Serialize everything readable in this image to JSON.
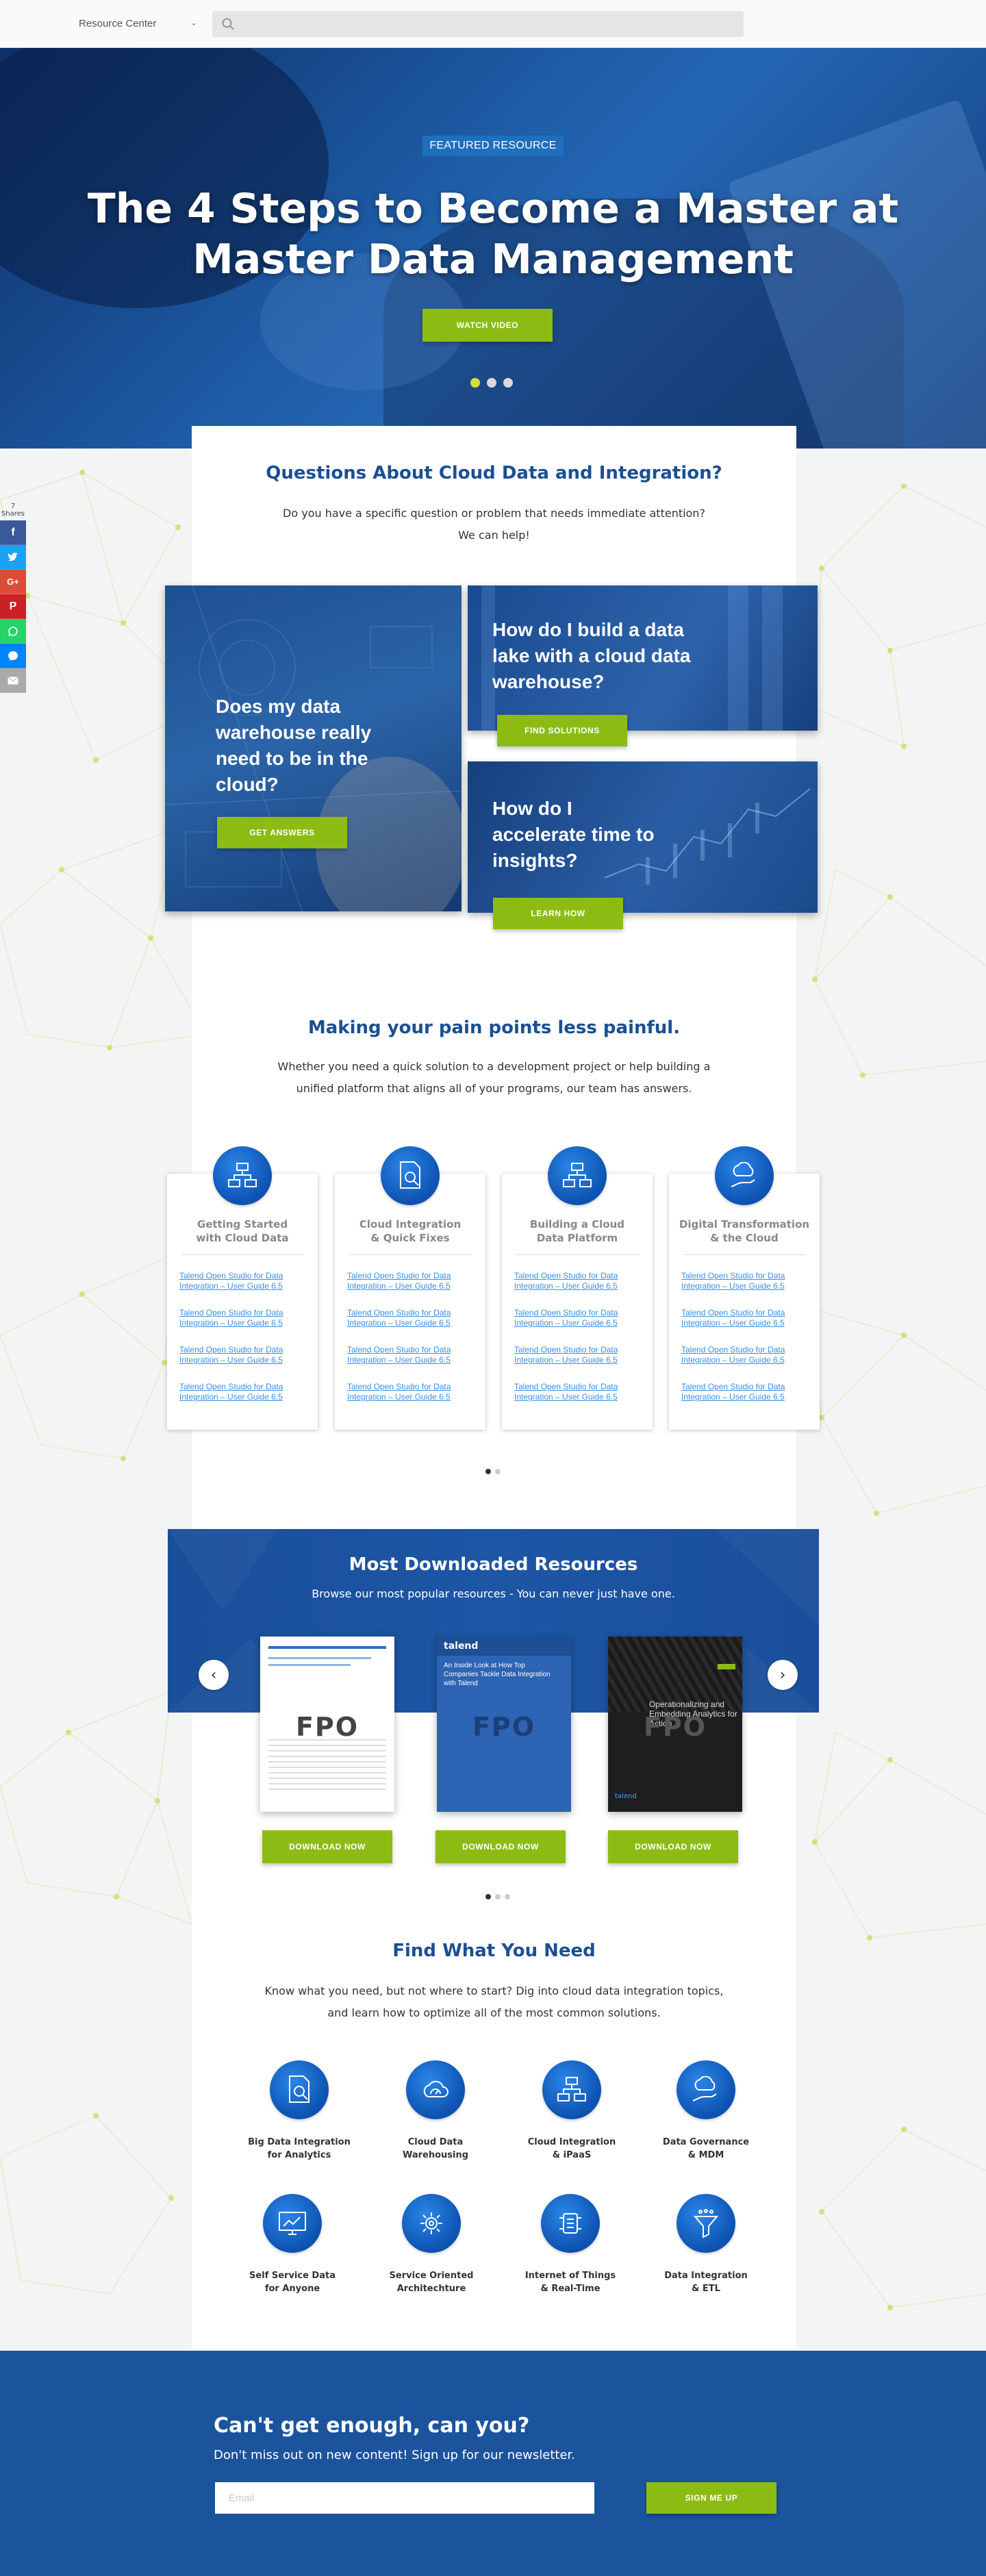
{
  "nav": {
    "brand": "Resource Center",
    "search_placeholder": ""
  },
  "hero": {
    "tag": "FEATURED RESOURCE",
    "title": "The 4 Steps to Become a Master at Master Data Management",
    "button": "WATCH VIDEO",
    "slides": 3,
    "active_slide": 1
  },
  "share": {
    "count": "7",
    "count_label": "Shares",
    "buttons": [
      "facebook",
      "twitter",
      "google-plus",
      "pinterest",
      "whatsapp",
      "messenger",
      "email"
    ]
  },
  "questions": {
    "title": "Questions About Cloud Data and Integration?",
    "subtitle_line1": "Do you have a specific question or problem that needs immediate attention?",
    "subtitle_line2": "We can help!",
    "cards": [
      {
        "text": "Does my data warehouse really need to be in the cloud?",
        "button": "GET ANSWERS"
      },
      {
        "text": "How do I build a data lake with a cloud data warehouse?",
        "button": "FIND SOLUTIONS"
      },
      {
        "text": "How do I accelerate time to insights?",
        "button": "LEARN HOW"
      }
    ]
  },
  "pain": {
    "title": "Making your pain points less painful.",
    "subtitle_line1": "Whether you need a quick solution to a development project or help building a",
    "subtitle_line2": "unified platform that aligns all of your programs, our team has answers.",
    "cards": [
      {
        "title_line1": "Getting Started",
        "title_line2": "with Cloud Data",
        "icon": "database-network-icon",
        "links": [
          "Talend Open Studio for Data Integration – User Guide 6.5",
          "Talend Open Studio for Data Integration – User Guide 6.5",
          "Talend Open Studio for Data Integration – User Guide 6.5",
          "Talend Open Studio for Data Integration – User Guide 6.5"
        ]
      },
      {
        "title_line1": "Cloud Integration",
        "title_line2": "& Quick Fixes",
        "icon": "document-search-icon",
        "links": [
          "Talend Open Studio for Data Integration – User Guide 6.5",
          "Talend Open Studio for Data Integration – User Guide 6.5",
          "Talend Open Studio for Data Integration – User Guide 6.5",
          "Talend Open Studio for Data Integration – User Guide 6.5"
        ]
      },
      {
        "title_line1": "Building a Cloud",
        "title_line2": "Data Platform",
        "icon": "database-network-icon",
        "links": [
          "Talend Open Studio for Data Integration – User Guide 6.5",
          "Talend Open Studio for Data Integration – User Guide 6.5",
          "Talend Open Studio for Data Integration – User Guide 6.5",
          "Talend Open Studio for Data Integration – User Guide 6.5"
        ]
      },
      {
        "title_line1": "Digital Transformation",
        "title_line2": "& the Cloud",
        "icon": "cloud-hand-icon",
        "links": [
          "Talend Open Studio for Data Integration – User Guide 6.5",
          "Talend Open Studio for Data Integration – User Guide 6.5",
          "Talend Open Studio for Data Integration – User Guide 6.5",
          "Talend Open Studio for Data Integration – User Guide 6.5"
        ]
      }
    ]
  },
  "downloads": {
    "title": "Most Downloaded Resources",
    "subtitle": "Browse our most popular resources - You can never just have one.",
    "fpo": "FPO",
    "book2_brand": "talend",
    "book2_title": "An Inside Look at How Top Companies Tackle Data Integration with Talend",
    "book3_title": "Operationalizing and Embedding Analytics for Action",
    "book3_brand": "talend",
    "button": "DOWNLOAD NOW"
  },
  "find": {
    "title": "Find What You Need",
    "subtitle_line1": "Know what you need, but not where to start? Dig into cloud data integration topics,",
    "subtitle_line2": "and learn how to optimize all of the most common solutions.",
    "topics": [
      {
        "line1": "Big Data Integration",
        "line2": "for Analytics",
        "icon": "document-search-icon"
      },
      {
        "line1": "Cloud Data",
        "line2": "Warehousing",
        "icon": "cloud-gauge-icon"
      },
      {
        "line1": "Cloud Integration",
        "line2": "& iPaaS",
        "icon": "database-network-icon"
      },
      {
        "line1": "Data Governance",
        "line2": "& MDM",
        "icon": "cloud-hand-icon"
      },
      {
        "line1": "Self Service Data",
        "line2": "for Anyone",
        "icon": "monitor-chart-icon"
      },
      {
        "line1": "Service Oriented",
        "line2": "Architechture",
        "icon": "gear-network-icon"
      },
      {
        "line1": "Internet of Things",
        "line2": "& Real-Time",
        "icon": "iot-device-icon"
      },
      {
        "line1": "Data Integration",
        "line2": "& ETL",
        "icon": "funnel-icon"
      }
    ]
  },
  "footer": {
    "title": "Can't get enough, can you?",
    "subtitle": "Don't miss out on new content! Sign up for our newsletter.",
    "email_placeholder": "Email",
    "button": "SIGN ME UP"
  },
  "colors": {
    "brand_blue": "#1b4f94",
    "accent_green": "#8cbc14",
    "footer_blue": "#1b539d",
    "link_blue": "#3a8ee6"
  }
}
